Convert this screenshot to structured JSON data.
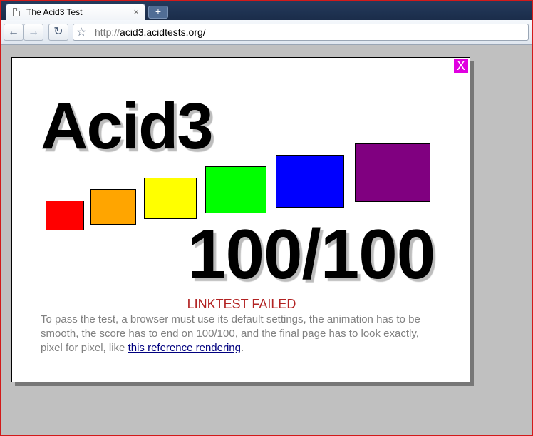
{
  "browser": {
    "tab_title": "The Acid3 Test",
    "tab_close": "×",
    "new_tab": "+",
    "back_icon": "←",
    "forward_icon": "→",
    "reload_icon": "↻",
    "star_icon": "☆",
    "url_scheme": "http://",
    "url_host": "acid3.acidtests.org/"
  },
  "test": {
    "close_label": "X",
    "title": "Acid3",
    "score": "100/100",
    "status": "LINKTEST FAILED",
    "description_before": "To pass the test, a browser must use its default settings, the animation has to be smooth, the score has to end on 100/100, and the final page has to look exactly, pixel for pixel, like ",
    "link_text": "this reference rendering",
    "description_after": ".",
    "bucket_colors": [
      "#ff0000",
      "#ffa500",
      "#ffff00",
      "#00ff00",
      "#0000ff",
      "#800080"
    ]
  }
}
